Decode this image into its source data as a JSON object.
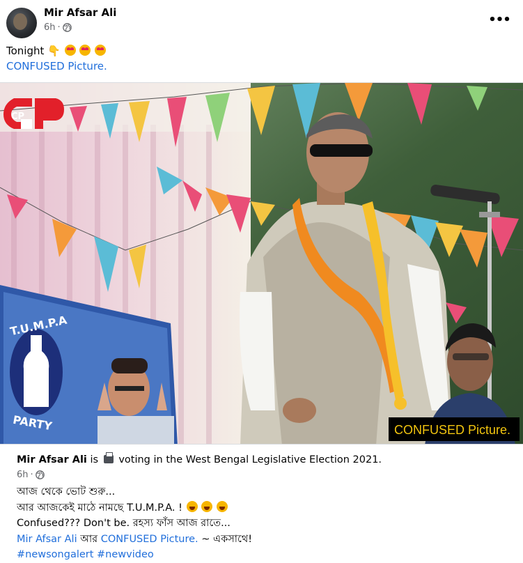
{
  "post": {
    "author": "Mir Afsar Ali",
    "time": "6h",
    "privacy_icon": "globe-icon",
    "more_icon": "more-options-icon",
    "caption_line1": "Tonight",
    "caption_emoji": [
      "pointing-down-hand",
      "heart-eyes",
      "heart-eyes",
      "heart-eyes"
    ],
    "caption_link": "CONFUSED Picture."
  },
  "photo": {
    "logo_text": "CP",
    "banner_top_text": "T.U.M.P.A",
    "banner_bottom_text": "PARTY",
    "watermark": "CONFUSED Picture."
  },
  "shared_post": {
    "author": "Mir Afsar Ali",
    "is_text": "is",
    "activity_icon": "ballot-box-icon",
    "activity": "voting in the West Bengal Legislative Election 2021.",
    "time": "6h",
    "line1": "আজ থেকে ভোট শুরু...",
    "line2": "আর আজকেই মাঠে নামছে T.U.M.P.A. !",
    "line2_emoji": [
      "grinning-face",
      "grinning-face",
      "grinning-face"
    ],
    "line3": "Confused??? Don't be. রহস্য ফাঁস আজ রাতে...",
    "line4_link1": "Mir Afsar Ali",
    "line4_mid": "আর",
    "line4_link2": "CONFUSED Picture.",
    "line4_end": "~ একসাথে!",
    "hashtags": "#newsongalert #newvideo"
  },
  "colors": {
    "link": "#216fdb",
    "secondary_text": "#65676b",
    "primary_text": "#050505"
  }
}
